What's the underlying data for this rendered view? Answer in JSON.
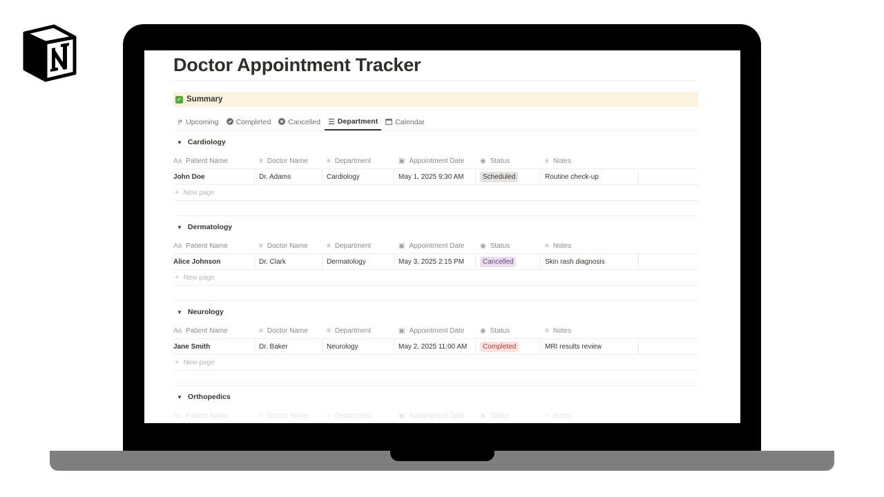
{
  "page": {
    "title": "Doctor Appointment Tracker",
    "summary_label": "Summary"
  },
  "tabs": [
    {
      "label": "Upcoming",
      "icon": "redo-arrow-icon",
      "active": false
    },
    {
      "label": "Completed",
      "icon": "check-circle-icon",
      "active": false
    },
    {
      "label": "Cancelled",
      "icon": "x-circle-icon",
      "active": false
    },
    {
      "label": "Department",
      "icon": "list-icon",
      "active": true
    },
    {
      "label": "Calendar",
      "icon": "calendar-icon",
      "active": false
    }
  ],
  "columns": {
    "patient": "Patient Name",
    "doctor": "Doctor Name",
    "department": "Department",
    "date": "Appointment Date",
    "status": "Status",
    "notes": "Notes",
    "title_icon_text": "Aa"
  },
  "new_page_label": "New page",
  "groups": [
    {
      "name": "Cardiology",
      "rows": [
        {
          "patient": "John Doe",
          "doctor": "Dr. Adams",
          "department": "Cardiology",
          "date": "May 1, 2025 9:30 AM",
          "status": "Scheduled",
          "notes": "Routine check-up"
        }
      ]
    },
    {
      "name": "Dermatology",
      "rows": [
        {
          "patient": "Alice Johnson",
          "doctor": "Dr. Clark",
          "department": "Dermatology",
          "date": "May 3, 2025 2:15 PM",
          "status": "Cancelled",
          "notes": "Skin rash diagnosis"
        }
      ]
    },
    {
      "name": "Neurology",
      "rows": [
        {
          "patient": "Jane Smith",
          "doctor": "Dr. Baker",
          "department": "Neurology",
          "date": "May 2, 2025 11:00 AM",
          "status": "Completed",
          "notes": "MRI results review"
        }
      ]
    },
    {
      "name": "Orthopedics",
      "rows": []
    }
  ],
  "colors": {
    "summary_bg": "#fbf3de",
    "scheduled_bg": "#e3e2e0",
    "cancelled_bg": "#e8deee",
    "completed_bg": "#ffe2dd",
    "laptop_base": "#7f7f7f"
  }
}
